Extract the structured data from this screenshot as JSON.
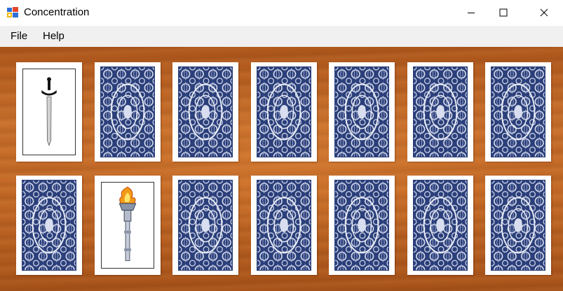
{
  "window": {
    "title": "Concentration",
    "icon": "windows-app-icon",
    "controls": [
      "minimize-icon",
      "maximize-icon",
      "close-icon"
    ]
  },
  "menu": {
    "items": [
      {
        "label": "File"
      },
      {
        "label": "Help"
      }
    ]
  },
  "board": {
    "background": "wood-table",
    "rows": 2,
    "columns": 7,
    "card_back_color": "#2b3f7a",
    "cards": [
      {
        "state": "face-up",
        "face": "sword"
      },
      {
        "state": "face-down"
      },
      {
        "state": "face-down"
      },
      {
        "state": "face-down"
      },
      {
        "state": "face-down"
      },
      {
        "state": "face-down"
      },
      {
        "state": "face-down"
      },
      {
        "state": "face-down"
      },
      {
        "state": "face-up",
        "face": "torch"
      },
      {
        "state": "face-down"
      },
      {
        "state": "face-down"
      },
      {
        "state": "face-down"
      },
      {
        "state": "face-down"
      },
      {
        "state": "face-down"
      }
    ]
  }
}
